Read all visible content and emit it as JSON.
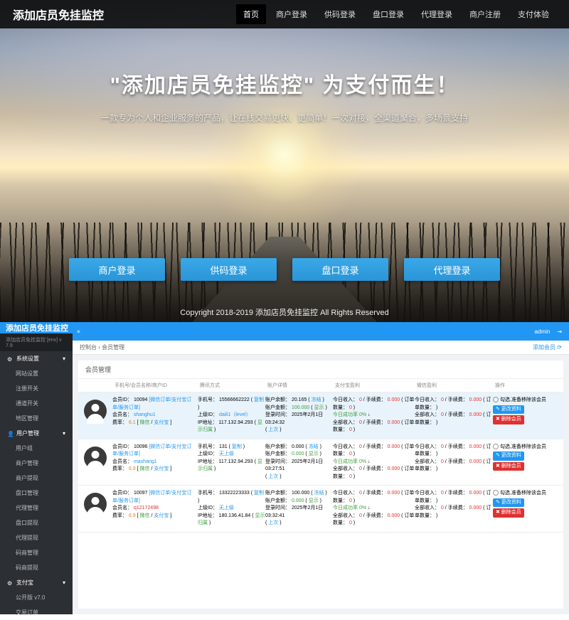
{
  "landing": {
    "brand": "添加店员免挂监控",
    "nav": [
      "首页",
      "商户登录",
      "供码登录",
      "盘口登录",
      "代理登录",
      "商户注册",
      "支付体验"
    ],
    "hero_title": "\"添加店员免挂监控\"   为支付而生！",
    "hero_sub": "一款专为个人和企业服务的产品，让在线交易更快、更简单！一次对接，全渠道聚合，多场景支持",
    "cta": [
      "商户登录",
      "供码登录",
      "盘口登录",
      "代理登录"
    ],
    "copyright": "Copyright 2018-2019 添加店员免挂监控 All Rights Reserved"
  },
  "admin": {
    "brand": "添加店员免挂监控",
    "side_sub": "添加店员免挂监控   [env]   v 7.9",
    "menu": [
      {
        "label": "系统设置",
        "type": "group",
        "icon": "gear"
      },
      {
        "label": "网站设置",
        "type": "sub"
      },
      {
        "label": "注册开关",
        "type": "sub"
      },
      {
        "label": "通道开关",
        "type": "sub"
      },
      {
        "label": "地区管理",
        "type": "sub"
      },
      {
        "label": "用户管理",
        "type": "group",
        "icon": "user"
      },
      {
        "label": "用户组",
        "type": "sub"
      },
      {
        "label": "商户管理",
        "type": "sub"
      },
      {
        "label": "商户提现",
        "type": "sub"
      },
      {
        "label": "盘口管理",
        "type": "sub"
      },
      {
        "label": "代理管理",
        "type": "sub"
      },
      {
        "label": "盘口提现",
        "type": "sub"
      },
      {
        "label": "代理提现",
        "type": "sub"
      },
      {
        "label": "码商管理",
        "type": "sub"
      },
      {
        "label": "码商提现",
        "type": "sub"
      },
      {
        "label": "支付宝",
        "type": "group",
        "icon": "cog"
      },
      {
        "label": "公开版 v7.0",
        "type": "sub"
      },
      {
        "label": "交易订单",
        "type": "sub"
      }
    ],
    "top_user": "admin",
    "breadcrumb_a": "控制台",
    "breadcrumb_b": "会员管理",
    "add_btn": "添加会员",
    "card_title": "会员管理",
    "columns": [
      "",
      "手机号/会员名称/商户ID",
      "腾讯方式",
      "账户详情",
      "支付宝盈利",
      "微信盈利",
      "操作"
    ],
    "labels": {
      "memid": "会员ID：",
      "memname": "会员名：",
      "fee": "费率：",
      "wx": "微信",
      "zfb": "支付宝",
      "phone": "手机号：",
      "copy": "复制",
      "upper": "上级ID：",
      "ip": "IP地址：",
      "show": "显示归属",
      "bal": "账户余额：",
      "freeze": "冻结",
      "amt": "账户金额：",
      "regtime": "登录时间：",
      "last": "上次",
      "today_in": "今日收入：",
      "today_fee": "手续费：",
      "orders": "订单数量：",
      "rate": "今日成功率",
      "all_in": "全部收入：",
      "op_sel": "勾选,准备移除该会员",
      "op_edit": "更改资料",
      "op_del": "删除会员"
    },
    "rows": [
      {
        "id": "10094",
        "links": "[微信订单/支付宝订单/服务订单]",
        "name": "shanghu1",
        "name_color": "blue",
        "fee": "6.1",
        "phone": "15566662222",
        "upper": "daili1（level）",
        "ip": "117.132.94.293",
        "bal": "20.165",
        "amt": "100.000",
        "time": "2025年2月1日 03:24:32",
        "today_in": "0",
        "today_fee": "0.000",
        "today_ord": "0",
        "rate": "0%",
        "all_in": "0",
        "all_fee": "0.000",
        "all_ord": "0"
      },
      {
        "id": "10096",
        "links": "[微信订单/支付宝订单/服务订单]",
        "name": "mashang1",
        "name_color": "blue",
        "fee": "6.9",
        "phone": "131",
        "upper": "无上级",
        "ip": "117.132.94.293",
        "bal": "0.000",
        "amt": "0.000",
        "time": "2025年2月1日 03:27:51",
        "today_in": "0",
        "today_fee": "0.000",
        "today_ord": "0",
        "rate": "0%",
        "all_in": "0",
        "all_fee": "0.000",
        "all_ord": "0"
      },
      {
        "id": "10097",
        "links": "[微信订单/支付宝订单/服务订单]",
        "name": "q12172498",
        "name_color": "red",
        "fee": "6.9",
        "phone": "13322223333",
        "upper": "无上级",
        "ip": "180.136.41.84",
        "bal": "100.000",
        "amt": "0.000",
        "time": "2025年2月1日 03:32:41",
        "today_in": "0",
        "today_fee": "0.000",
        "today_ord": "0",
        "rate": "0%",
        "all_in": "0",
        "all_fee": "0.000",
        "all_ord": "0"
      }
    ]
  }
}
